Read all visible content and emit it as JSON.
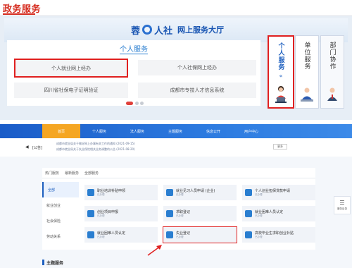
{
  "page_title": "政务服务",
  "portal": {
    "logo_char1": "蓉",
    "logo_char2": "人社",
    "title": "网上服务大厅"
  },
  "services": {
    "heading": "个人服务",
    "buttons": [
      {
        "label": "个人就业网上经办"
      },
      {
        "label": "个人社保网上经办"
      },
      {
        "label": "四川省社保电子证明验证"
      },
      {
        "label": "成都市专技人才信息系统"
      }
    ]
  },
  "side_tabs": {
    "personal": "个人服务",
    "arrow": "«",
    "unit": "单位服务",
    "dept": "部门协作"
  },
  "nav": {
    "items": [
      "首页",
      "个人服务",
      "法人服务",
      "主题服务",
      "信息公开",
      "用户中心"
    ]
  },
  "announcement": {
    "icon": "◀",
    "label": "[公告]",
    "notice_1": "成都市就业局关于做好网上办事有关工作的通知 (2021-09-15)",
    "notice_2": "成都市就业局关于失业保险相关业务调整的公告 (2021-08-20)",
    "more": "更多"
  },
  "main": {
    "tabs": [
      "热门服务",
      "最新服务",
      "全部服务"
    ],
    "side_menu": [
      "全部",
      "就业创业",
      "社会保险",
      "劳动关系"
    ],
    "cards": [
      {
        "title": "职业培训补贴申领",
        "sub": "已办理"
      },
      {
        "title": "就业见习人员申请 (企业)",
        "sub": "已办理"
      },
      {
        "title": "个人创业担保贷款申请",
        "sub": "已办理"
      },
      {
        "title": "创业项目申报",
        "sub": "已办理"
      },
      {
        "title": "求职登记",
        "sub": "已办理"
      },
      {
        "title": "就业困难人员认定",
        "sub": "已办理"
      },
      {
        "title": "就业困难人员认定",
        "sub": "已办理"
      },
      {
        "title": "失业登记",
        "sub": "已办理"
      },
      {
        "title": "高校毕业生求职创业补贴",
        "sub": "已办理"
      }
    ],
    "section_title": "主题服务"
  },
  "float_button": {
    "icon": "☰",
    "label": "服务目录"
  },
  "colors": {
    "accent_red": "#d52b1e",
    "nav_blue": "#1a5cc8",
    "nav_active": "#f5a623",
    "highlight_red": "#e02020"
  }
}
